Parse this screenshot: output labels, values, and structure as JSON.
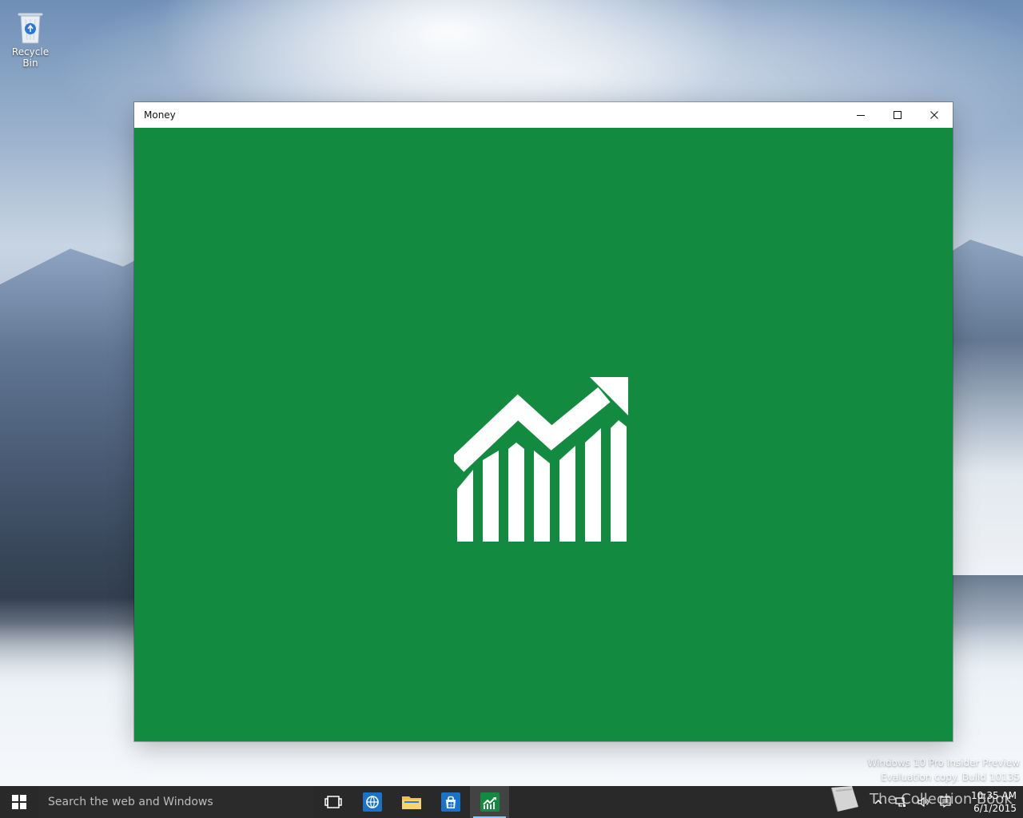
{
  "desktop": {
    "icons": [
      {
        "label": "Recycle Bin",
        "icon": "recycle-bin-icon"
      }
    ],
    "watermark": {
      "line1": "Windows 10 Pro Insider Preview",
      "line2": "Evaluation copy. Build 10135"
    },
    "corner_logo_text": "The Collection Book"
  },
  "window": {
    "title": "Money",
    "controls": {
      "minimize_icon": "minimize-icon",
      "maximize_icon": "maximize-icon",
      "close_icon": "close-icon"
    },
    "splash": {
      "background": "#128a3f",
      "logo_icon": "money-chart-icon"
    }
  },
  "taskbar": {
    "search_placeholder": "Search the web and Windows",
    "apps": [
      {
        "icon": "task-view-icon"
      },
      {
        "icon": "edge-icon"
      },
      {
        "icon": "file-explorer-icon"
      },
      {
        "icon": "store-icon"
      },
      {
        "icon": "money-app-icon",
        "active": true
      }
    ],
    "tray_icons": [
      "chevron-up-icon",
      "network-icon",
      "volume-icon",
      "action-center-icon"
    ],
    "clock": {
      "time": "10:35 AM",
      "date": "6/1/2015"
    }
  },
  "colors": {
    "money_green": "#128a3f",
    "taskbar": "#1c1c1c"
  }
}
